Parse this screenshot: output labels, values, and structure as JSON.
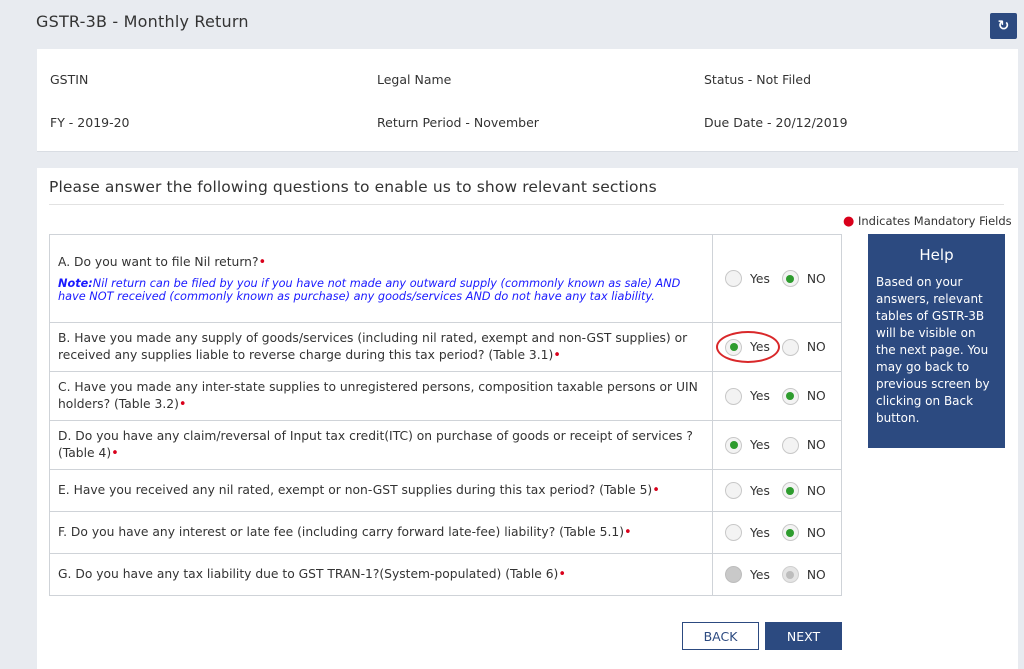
{
  "page": {
    "title": "GSTR-3B - Monthly Return"
  },
  "info": {
    "gstin": "GSTIN",
    "legal_name": "Legal Name",
    "status": "Status - Not Filed",
    "fy": "FY - 2019-20",
    "return_period": "Return Period - November",
    "due_date": "Due Date - 20/12/2019"
  },
  "section": {
    "title": "Please answer the following questions to enable us to show relevant sections",
    "mandatory_note": "Indicates Mandatory Fields"
  },
  "questions": [
    {
      "text": "A. Do you want to file Nil return?",
      "note_label": "Note:",
      "note_text": "Nil return can be filed by you if you have not made any outward supply (commonly known as sale) AND have NOT received (commonly known as purchase) any goods/services AND do not have any tax liability.",
      "selected": "NO"
    },
    {
      "text": "B. Have you made any supply of goods/services (including nil rated, exempt and non-GST supplies) or received any supplies liable to reverse charge during this tax period? (Table 3.1)",
      "selected": "Yes"
    },
    {
      "text": "C. Have you made any inter-state supplies to unregistered persons, composition taxable persons or UIN holders? (Table 3.2)",
      "selected": "NO"
    },
    {
      "text": "D. Do you have any claim/reversal of Input tax credit(ITC) on purchase of goods or receipt of services ? (Table 4)",
      "selected": "Yes"
    },
    {
      "text": "E. Have you received any nil rated, exempt or non-GST supplies during this tax period? (Table 5)",
      "selected": "NO"
    },
    {
      "text": "F. Do you have any interest or late fee (including carry forward late-fee) liability? (Table 5.1)",
      "selected": "NO"
    },
    {
      "text": "G. Do you have any tax liability due to GST TRAN-1?(System-populated) (Table 6)",
      "selected": "none",
      "disabled": true
    }
  ],
  "options": {
    "yes": "Yes",
    "no": "NO"
  },
  "help": {
    "title": "Help",
    "body": "Based on your answers, relevant tables of GSTR-3B will be visible on the next page. You may go back to previous screen by clicking on Back button."
  },
  "buttons": {
    "back": "BACK",
    "next": "NEXT"
  },
  "icons": {
    "refresh": "refresh-icon",
    "mandatory": "required-dot-icon"
  },
  "colors": {
    "primary": "#2c4a80",
    "required": "#d9001b",
    "selected_radio": "#2e9c2e",
    "note_text": "#1a1aff"
  }
}
